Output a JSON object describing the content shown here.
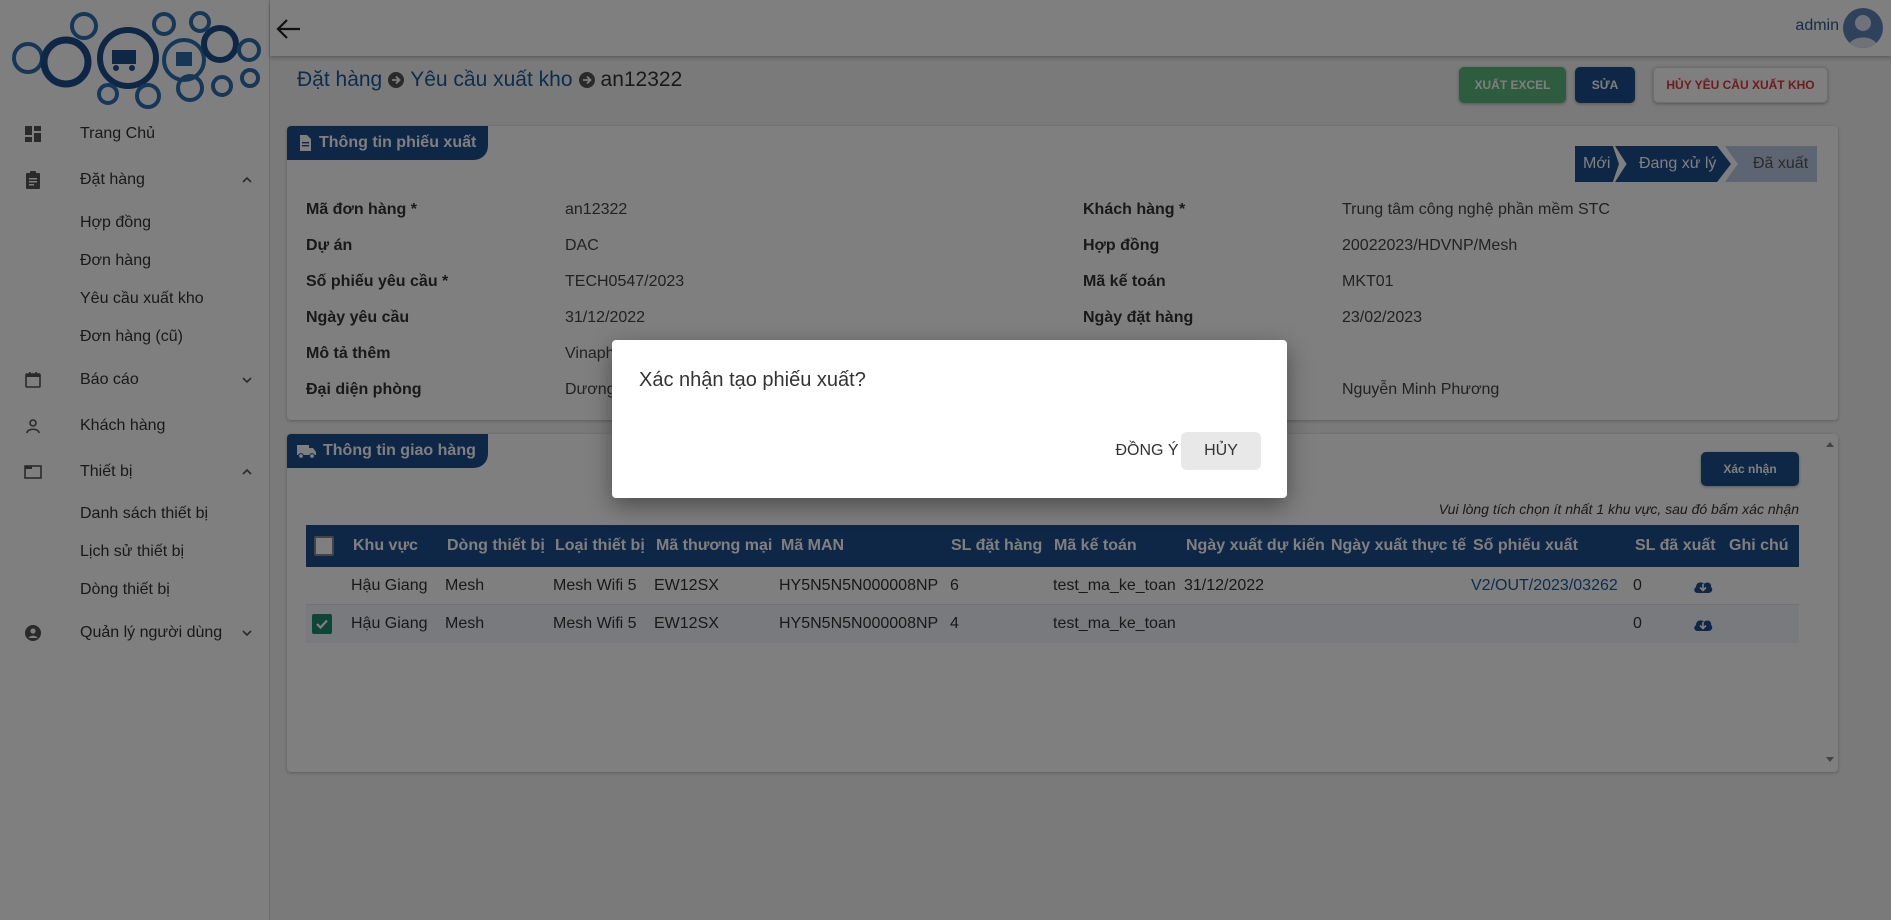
{
  "sidebar": {
    "logo_alt": "logo",
    "items": [
      {
        "label": "Trang Chủ",
        "icon": "dashboard-icon"
      },
      {
        "label": "Đặt hàng",
        "icon": "clipboard-icon",
        "expanded": true
      },
      {
        "label": "Báo cáo",
        "icon": "calendar-icon",
        "expanded": false
      },
      {
        "label": "Khách hàng",
        "icon": "person-icon"
      },
      {
        "label": "Thiết bị",
        "icon": "folder-icon",
        "expanded": true
      },
      {
        "label": "Quản lý người dùng",
        "icon": "account-circle-icon",
        "expanded": false
      }
    ],
    "dat_hang_sub": [
      "Hợp đồng",
      "Đơn hàng",
      "Yêu cầu xuất kho",
      "Đơn hàng (cũ)"
    ],
    "thiet_bi_sub": [
      "Danh sách thiết bị",
      "Lịch sử thiết bị",
      "Dòng thiết bị"
    ]
  },
  "topbar": {
    "user": "admin"
  },
  "breadcrumb": [
    "Đặt hàng",
    "Yêu cầu xuất kho",
    "an12322"
  ],
  "actions": {
    "export_excel": "Xuất Excel",
    "edit": "Sửa",
    "cancel_request": "Hủy yêu cầu xuất kho"
  },
  "info": {
    "tab_label": "Thông tin phiếu xuất",
    "steps": [
      "Mới",
      "Đang xử lý",
      "Đã xuất"
    ],
    "active_step": 1,
    "left": [
      {
        "label": "Mã đơn hàng *",
        "value": "an12322"
      },
      {
        "label": "Dự án",
        "value": "DAC"
      },
      {
        "label": "Số phiếu yêu cầu *",
        "value": "TECH0547/2023"
      },
      {
        "label": "Ngày yêu cầu",
        "value": "31/12/2022"
      },
      {
        "label": "Mô tả thêm",
        "value": "Vinaph"
      },
      {
        "label": "Đại diện phòng",
        "value": "Dương"
      }
    ],
    "right": [
      {
        "label": "Khách hàng *",
        "value": "Trung tâm công nghệ phần mềm STC"
      },
      {
        "label": "Hợp đồng",
        "value": "20022023/HDVNP/Mesh"
      },
      {
        "label": "Mã kế toán",
        "value": "MKT01"
      },
      {
        "label": "Ngày đặt hàng",
        "value": "23/02/2023"
      },
      {
        "label": "",
        "value": ""
      },
      {
        "label": "",
        "value": "Nguyễn Minh Phương"
      }
    ]
  },
  "delivery": {
    "tab_label": "Thông tin giao hàng",
    "confirm_button": "Xác nhận",
    "hint": "Vui lòng tích chọn ít nhất 1 khu vực, sau đó bấm xác nhận",
    "columns": [
      "Khu vực",
      "Dòng thiết bị",
      "Loại thiết bị",
      "Mã thương mại",
      "Mã MAN",
      "SL đặt hàng",
      "Mã kế toán",
      "Ngày xuất dự kiến",
      "Ngày xuất thực tế",
      "Số phiếu xuất",
      "SL đã xuất",
      "Ghi chú"
    ],
    "rows": [
      {
        "checked": false,
        "khu_vuc": "Hậu Giang",
        "dong": "Mesh",
        "loai": "Mesh Wifi 5",
        "ma_tm": "EW12SX",
        "ma_man": "HY5N5N5N000008NP",
        "sl_dat": "6",
        "ma_kt": "test_ma_ke_toan",
        "ngay_dk": "31/12/2022",
        "ngay_tt": "",
        "so_phieu": "V2/OUT/2023/03262",
        "sl_xuat": "0"
      },
      {
        "checked": true,
        "khu_vuc": "Hậu Giang",
        "dong": "Mesh",
        "loai": "Mesh Wifi 5",
        "ma_tm": "EW12SX",
        "ma_man": "HY5N5N5N000008NP",
        "sl_dat": "4",
        "ma_kt": "test_ma_ke_toan",
        "ngay_dk": "",
        "ngay_tt": "",
        "so_phieu": "",
        "sl_xuat": "0"
      }
    ]
  },
  "dialog": {
    "title": "Xác nhận tạo phiếu xuất?",
    "ok": "Đồng ý",
    "cancel": "Hủy"
  },
  "colors": {
    "primary": "#1f4e8c",
    "success": "#5aba7d",
    "danger": "#e0373f",
    "checked": "#1a8a6e"
  }
}
